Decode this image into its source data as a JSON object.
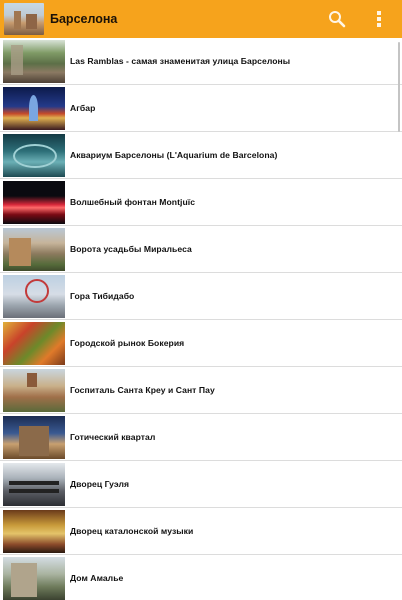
{
  "appbar": {
    "title": "Барселона",
    "logo_icon": "barcelona-thumb-icon",
    "search_icon": "search-icon",
    "menu_icon": "overflow-menu-icon",
    "background": "#f6a31c"
  },
  "places": [
    {
      "title": "Las Ramblas - самая знаменитая улица Барселоны"
    },
    {
      "title": "Агбар"
    },
    {
      "title": "Аквариум Барселоны (L'Aquarium de Barcelona)"
    },
    {
      "title": "Волшебный фонтан Montjuïc"
    },
    {
      "title": "Ворота усадьбы Миральеса"
    },
    {
      "title": "Гора Тибидабо"
    },
    {
      "title": "Городской рынок Бокерия"
    },
    {
      "title": "Госпиталь Санта Креу и Сант Пау"
    },
    {
      "title": "Готический квартал"
    },
    {
      "title": "Дворец Гуэля"
    },
    {
      "title": "Дворец каталонской музыки"
    },
    {
      "title": "Дом Амалье"
    }
  ]
}
